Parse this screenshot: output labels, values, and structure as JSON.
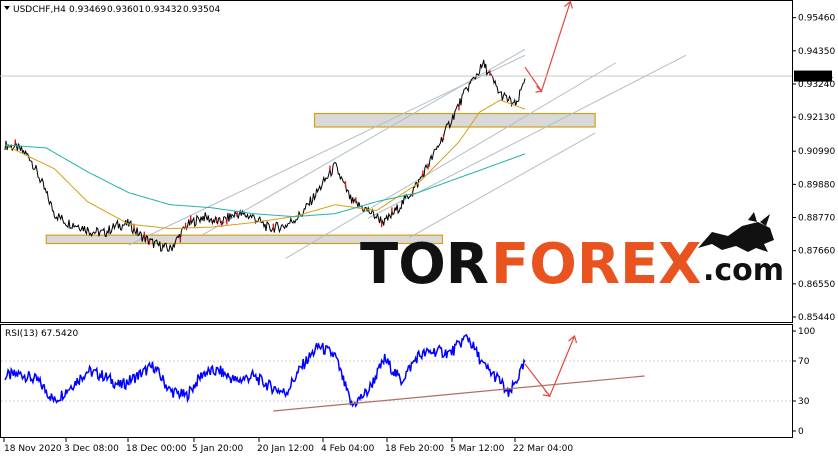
{
  "chart_data": [
    {
      "type": "line",
      "title": "USDCHF,H4",
      "ohlc_header": [
        "0.93469",
        "0.93601",
        "0.93432",
        "0.93504"
      ],
      "current_price": "0.93504",
      "ylim": [
        0.8534,
        0.9595
      ],
      "yticks": [
        {
          "value": 0.9546,
          "label": "0.95460"
        },
        {
          "value": 0.9435,
          "label": "0.94350"
        },
        {
          "value": 0.9324,
          "label": "0.93240"
        },
        {
          "value": 0.9213,
          "label": "0.92130"
        },
        {
          "value": 0.9099,
          "label": "0.90990"
        },
        {
          "value": 0.8988,
          "label": "0.89880"
        },
        {
          "value": 0.8877,
          "label": "0.88770"
        },
        {
          "value": 0.8766,
          "label": "0.87660"
        },
        {
          "value": 0.8655,
          "label": "0.86550"
        },
        {
          "value": 0.8544,
          "label": "0.85440"
        }
      ],
      "grid": false,
      "series": [
        {
          "key": "price",
          "color": "#000000",
          "x": [
            0,
            3,
            6,
            9,
            12,
            15,
            18,
            21,
            24,
            27,
            30,
            33,
            36,
            40,
            44,
            48,
            52,
            56,
            60,
            64,
            68,
            72,
            76,
            80,
            84,
            88,
            92,
            96,
            100,
            104,
            108,
            112,
            116,
            120,
            124,
            126
          ],
          "y": [
            0.912,
            0.911,
            0.908,
            0.899,
            0.889,
            0.886,
            0.885,
            0.883,
            0.8825,
            0.885,
            0.8855,
            0.8815,
            0.879,
            0.877,
            0.885,
            0.888,
            0.886,
            0.889,
            0.888,
            0.884,
            0.885,
            0.889,
            0.897,
            0.905,
            0.893,
            0.89,
            0.886,
            0.892,
            0.899,
            0.909,
            0.92,
            0.931,
            0.939,
            0.929,
            0.925,
            0.935
          ]
        },
        {
          "key": "ma_fast",
          "color": "#d4a017",
          "x": [
            0,
            12,
            20,
            30,
            40,
            50,
            60,
            70,
            80,
            90,
            100,
            110,
            115,
            120,
            126
          ],
          "y": [
            0.912,
            0.904,
            0.893,
            0.8855,
            0.884,
            0.8845,
            0.886,
            0.888,
            0.892,
            0.89,
            0.899,
            0.913,
            0.923,
            0.927,
            0.924
          ]
        },
        {
          "key": "ma_slow",
          "color": "#20b2aa",
          "x": [
            0,
            10,
            20,
            30,
            40,
            50,
            60,
            70,
            80,
            90,
            100,
            110,
            120,
            126
          ],
          "y": [
            0.912,
            0.911,
            0.903,
            0.896,
            0.892,
            0.891,
            0.889,
            0.888,
            0.889,
            0.893,
            0.896,
            0.901,
            0.906,
            0.909
          ]
        }
      ],
      "levels": [
        {
          "from": 10,
          "to": 106,
          "y_low": 0.879,
          "y_high": 0.8818,
          "color": "#d4a017"
        },
        {
          "from": 75,
          "to": 143,
          "y_low": 0.918,
          "y_high": 0.9225,
          "color": "#d4a017"
        }
      ],
      "forecast_color": "#e4473c"
    },
    {
      "type": "line",
      "title": "RSI(13) 67.5420",
      "ylim": [
        -5,
        105
      ],
      "yticks": [
        {
          "value": 100,
          "label": "100"
        },
        {
          "value": 70,
          "label": "70"
        },
        {
          "value": 30,
          "label": "30"
        },
        {
          "value": 0,
          "label": "0"
        }
      ],
      "series": [
        {
          "key": "rsi",
          "color": "#0000ff",
          "x": [
            0,
            4,
            8,
            12,
            16,
            20,
            24,
            28,
            32,
            36,
            40,
            44,
            48,
            52,
            56,
            60,
            64,
            68,
            72,
            76,
            80,
            84,
            88,
            92,
            96,
            100,
            104,
            108,
            112,
            116,
            120,
            122,
            126
          ],
          "y": [
            55,
            57,
            50,
            30,
            45,
            60,
            55,
            45,
            55,
            65,
            40,
            35,
            58,
            60,
            50,
            55,
            45,
            38,
            65,
            85,
            75,
            25,
            40,
            72,
            50,
            75,
            80,
            78,
            95,
            65,
            50,
            35,
            67.5
          ]
        },
        {
          "key": "rsi_trend",
          "color": "#b07060",
          "x": [
            65,
            155
          ],
          "y": [
            20,
            55
          ]
        }
      ]
    }
  ],
  "xaxis_labels": [
    "18 Nov 2020",
    "3 Dec 08:00",
    "18 Dec 00:00",
    "5 Jan 20:00",
    "20 Jan 12:00",
    "4 Feb 04:00",
    "18 Feb 20:00",
    "5 Mar 12:00",
    "22 Mar 04:00"
  ],
  "watermark": {
    "part1": "TOR",
    "part2": "FOREX",
    "suffix": ".com"
  }
}
